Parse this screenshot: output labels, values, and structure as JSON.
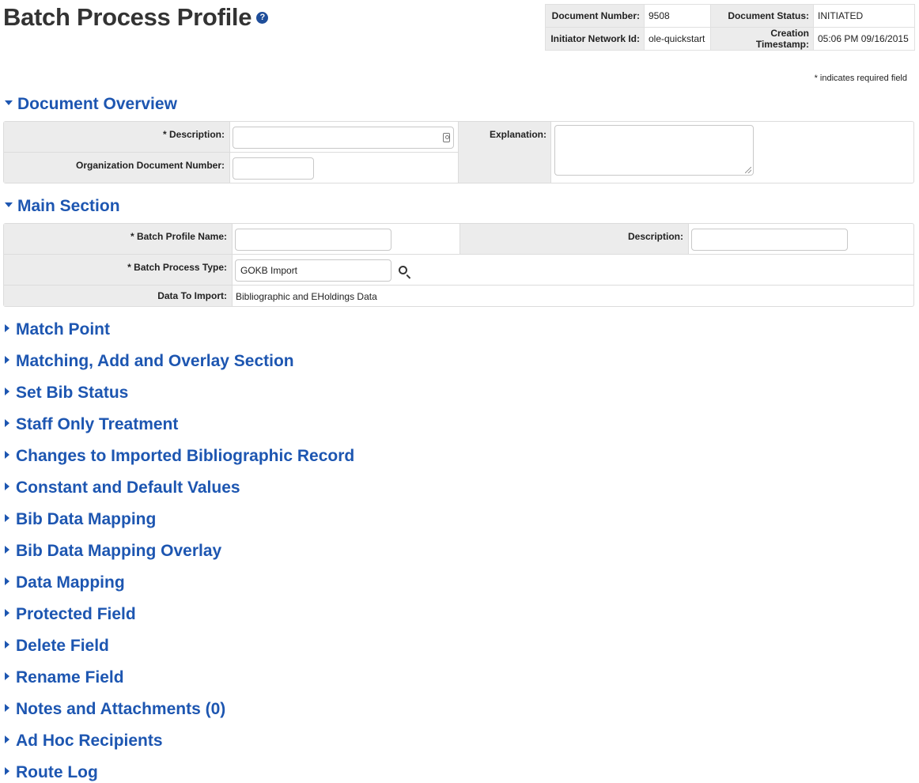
{
  "page": {
    "title": "Batch Process Profile",
    "help_glyph": "?"
  },
  "doc_info": {
    "document_number_label": "Document Number:",
    "document_number": "9508",
    "document_status_label": "Document Status:",
    "document_status": "INITIATED",
    "initiator_label": "Initiator Network Id:",
    "initiator": "ole-quickstart",
    "creation_label": "Creation Timestamp:",
    "creation": "05:06 PM 09/16/2015"
  },
  "required_note": "* indicates required field",
  "document_overview": {
    "header": "Document Overview",
    "description_label": "* Description:",
    "description_value": "",
    "org_doc_number_label": "Organization Document Number:",
    "org_doc_number_value": "",
    "explanation_label": "Explanation:",
    "explanation_value": ""
  },
  "main_section": {
    "header": "Main Section",
    "batch_profile_name_label": "* Batch Profile Name:",
    "batch_profile_name_value": "",
    "description_label": "Description:",
    "description_value": "",
    "batch_process_type_label": "* Batch Process Type:",
    "batch_process_type_value": "GOKB Import",
    "data_to_import_label": "Data To Import:",
    "data_to_import_value": "Bibliographic and EHoldings Data"
  },
  "collapsed_sections": [
    "Match Point",
    "Matching, Add and Overlay Section",
    "Set Bib Status",
    "Staff Only Treatment",
    "Changes to Imported Bibliographic Record",
    "Constant and Default Values",
    "Bib Data Mapping",
    "Bib Data Mapping Overlay",
    "Data Mapping",
    "Protected Field",
    "Delete Field",
    "Rename Field",
    "Notes and Attachments (0)",
    "Ad Hoc Recipients",
    "Route Log"
  ],
  "icons": {
    "expanded": "triangle-down-icon",
    "collapsed": "triangle-right-icon",
    "lookup": "magnifier-icon",
    "help": "help-icon"
  },
  "colors": {
    "section_header": "#1d56b1",
    "label_bg": "#ececec",
    "title": "#333333"
  }
}
